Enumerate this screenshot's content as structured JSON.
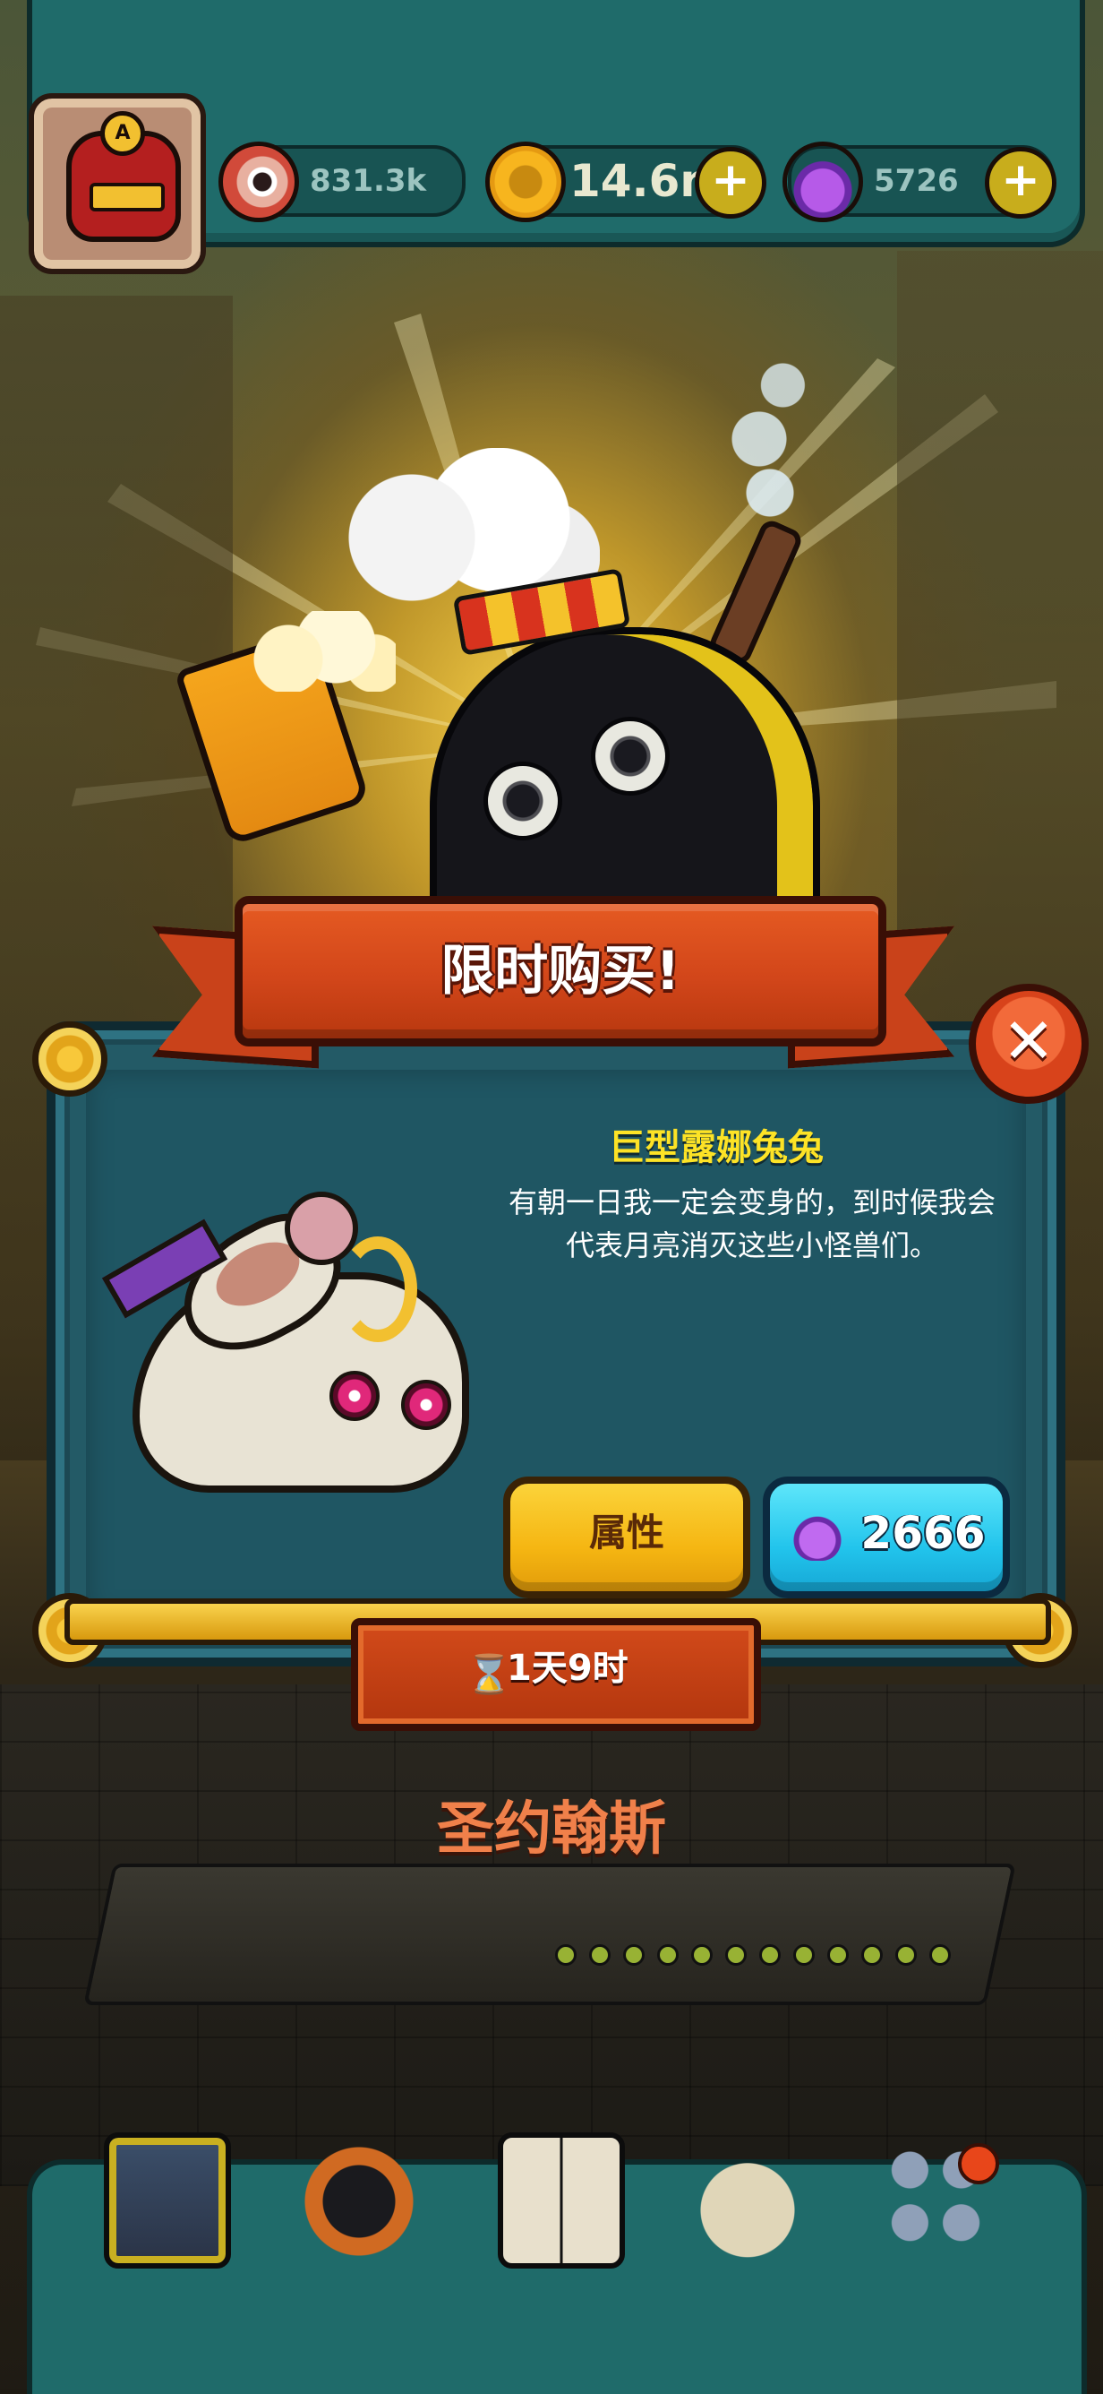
{
  "hud": {
    "eyes": "831.3k",
    "coins": "14.6m",
    "potions": "5726",
    "avatar_rank": "A",
    "coins_plus": "+",
    "potions_plus": "+"
  },
  "offer": {
    "banner_title": "限时购买!",
    "close_label": "✕",
    "item_name": "巨型露娜兔兔",
    "item_description": "有朝一日我一定会变身的，到时候我会代表月亮消灭这些小怪兽们。",
    "attributes_button": "属性",
    "price": "2666",
    "timer": "1天9时",
    "timer_icon": "⌛"
  },
  "scene": {
    "location_name": "圣约翰斯"
  },
  "colors": {
    "hud_teal": "#1f6b6a",
    "banner_orange": "#d2461a",
    "title_yellow": "#fde326",
    "attr_yellow": "#f5b612",
    "buy_cyan": "#22c4ec",
    "location_orange": "#f0804a"
  },
  "icons": {
    "eyes": "eyeball-icon",
    "coins": "gold-coin-icon",
    "potions": "purple-potion-icon",
    "close": "close-icon",
    "price": "purple-potion-icon",
    "timer": "hourglass-icon"
  },
  "nav": {
    "items": [
      "shop-icon",
      "monster-icon",
      "book-icon",
      "money-bag-icon",
      "grid-menu-icon"
    ]
  }
}
